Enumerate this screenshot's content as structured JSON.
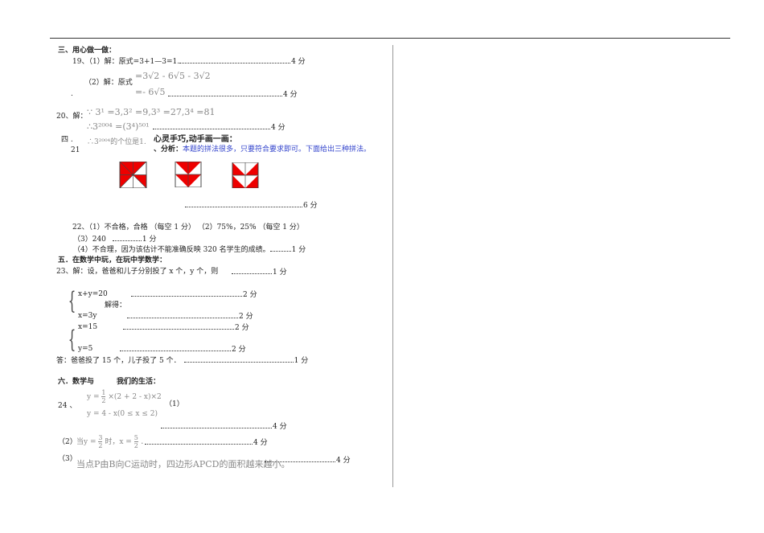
{
  "section3": {
    "title": "三、用心做一做："
  },
  "q19": {
    "p1": "19、（1）解：原式=3+1—3=1.",
    "p1_score": "4 分",
    "p2_label": "（2）解：原式",
    "p2_line1": "=3√2 - 6√5 - 3√2",
    "p2_line2": "=- 6√5",
    "p2_score": "4 分",
    "p2_dot": "."
  },
  "q20": {
    "label": "20、解：",
    "line1": "∵ 3¹ =3,3² =9,3³ =27,3⁴ =81",
    "line2": "∴3²⁰⁰⁴ =(3⁴)⁵⁰¹",
    "line3": "∴3²⁰⁰⁴的个位是1.",
    "score": "4 分"
  },
  "section4": {
    "num": "四 .",
    "title": "心灵手巧,动手画一画："
  },
  "q21": {
    "num": "21",
    "analysis_label": "、分析：",
    "analysis_text": "本题的拼法很多，只要符合要求即可。下面给出三种拼法。",
    "score": "6 分"
  },
  "q22": {
    "p1": "22、（1）不合格，合格 （每空 1 分）  （2）75%，25% （每空 1 分）",
    "p3": "（3）240",
    "p3_score": "1 分",
    "p4": "（4）不合理，因为该估计不能准确反映 320 名学生的成绩。",
    "p4_score": "1 分"
  },
  "section5": {
    "title": "五．在数学中玩，在玩中学数学："
  },
  "q23": {
    "intro": "23、解：设，爸爸和儿子分别投了 x 个，y 个，则",
    "intro_score": "1 分",
    "eq1": "x+y=20",
    "eq1_score": "2 分",
    "solve": "解得：",
    "eq2": "x=3y",
    "eq2_score": "2 分",
    "sol1": "x=15",
    "sol1_score": "2 分",
    "sol2": "y=5",
    "sol2_score": "2 分",
    "answer": "答：爸爸投了 15 个，儿子投了 5 个．",
    "answer_score": "1 分"
  },
  "section6": {
    "title_a": "六．数学与",
    "title_b": "我们的生活："
  },
  "q24": {
    "num": "24 、",
    "f1_pre": "y =",
    "f1_num": "1",
    "f1_den": "2",
    "f1_post": "×(2 + 2 - x)×2",
    "f2": "y = 4 - x(0 ≤ x ≤ 2)",
    "p1_label": "（1）",
    "p1_score": "4 分",
    "p2_label": "（2）",
    "p2_a": "当y =",
    "p2_num1": "3",
    "p2_den1": "2",
    "p2_b": "时，x =",
    "p2_num2": "5",
    "p2_den2": "2",
    "p2_c": "．",
    "p2_score": "4 分",
    "p3_label": "（3）",
    "p3_text": "当点P由B向C运动时，四边形APCD的面积越来越小。",
    "p3_score": "4 分"
  },
  "colors": {
    "red": "#ee0000",
    "blue": "#3344cc"
  }
}
